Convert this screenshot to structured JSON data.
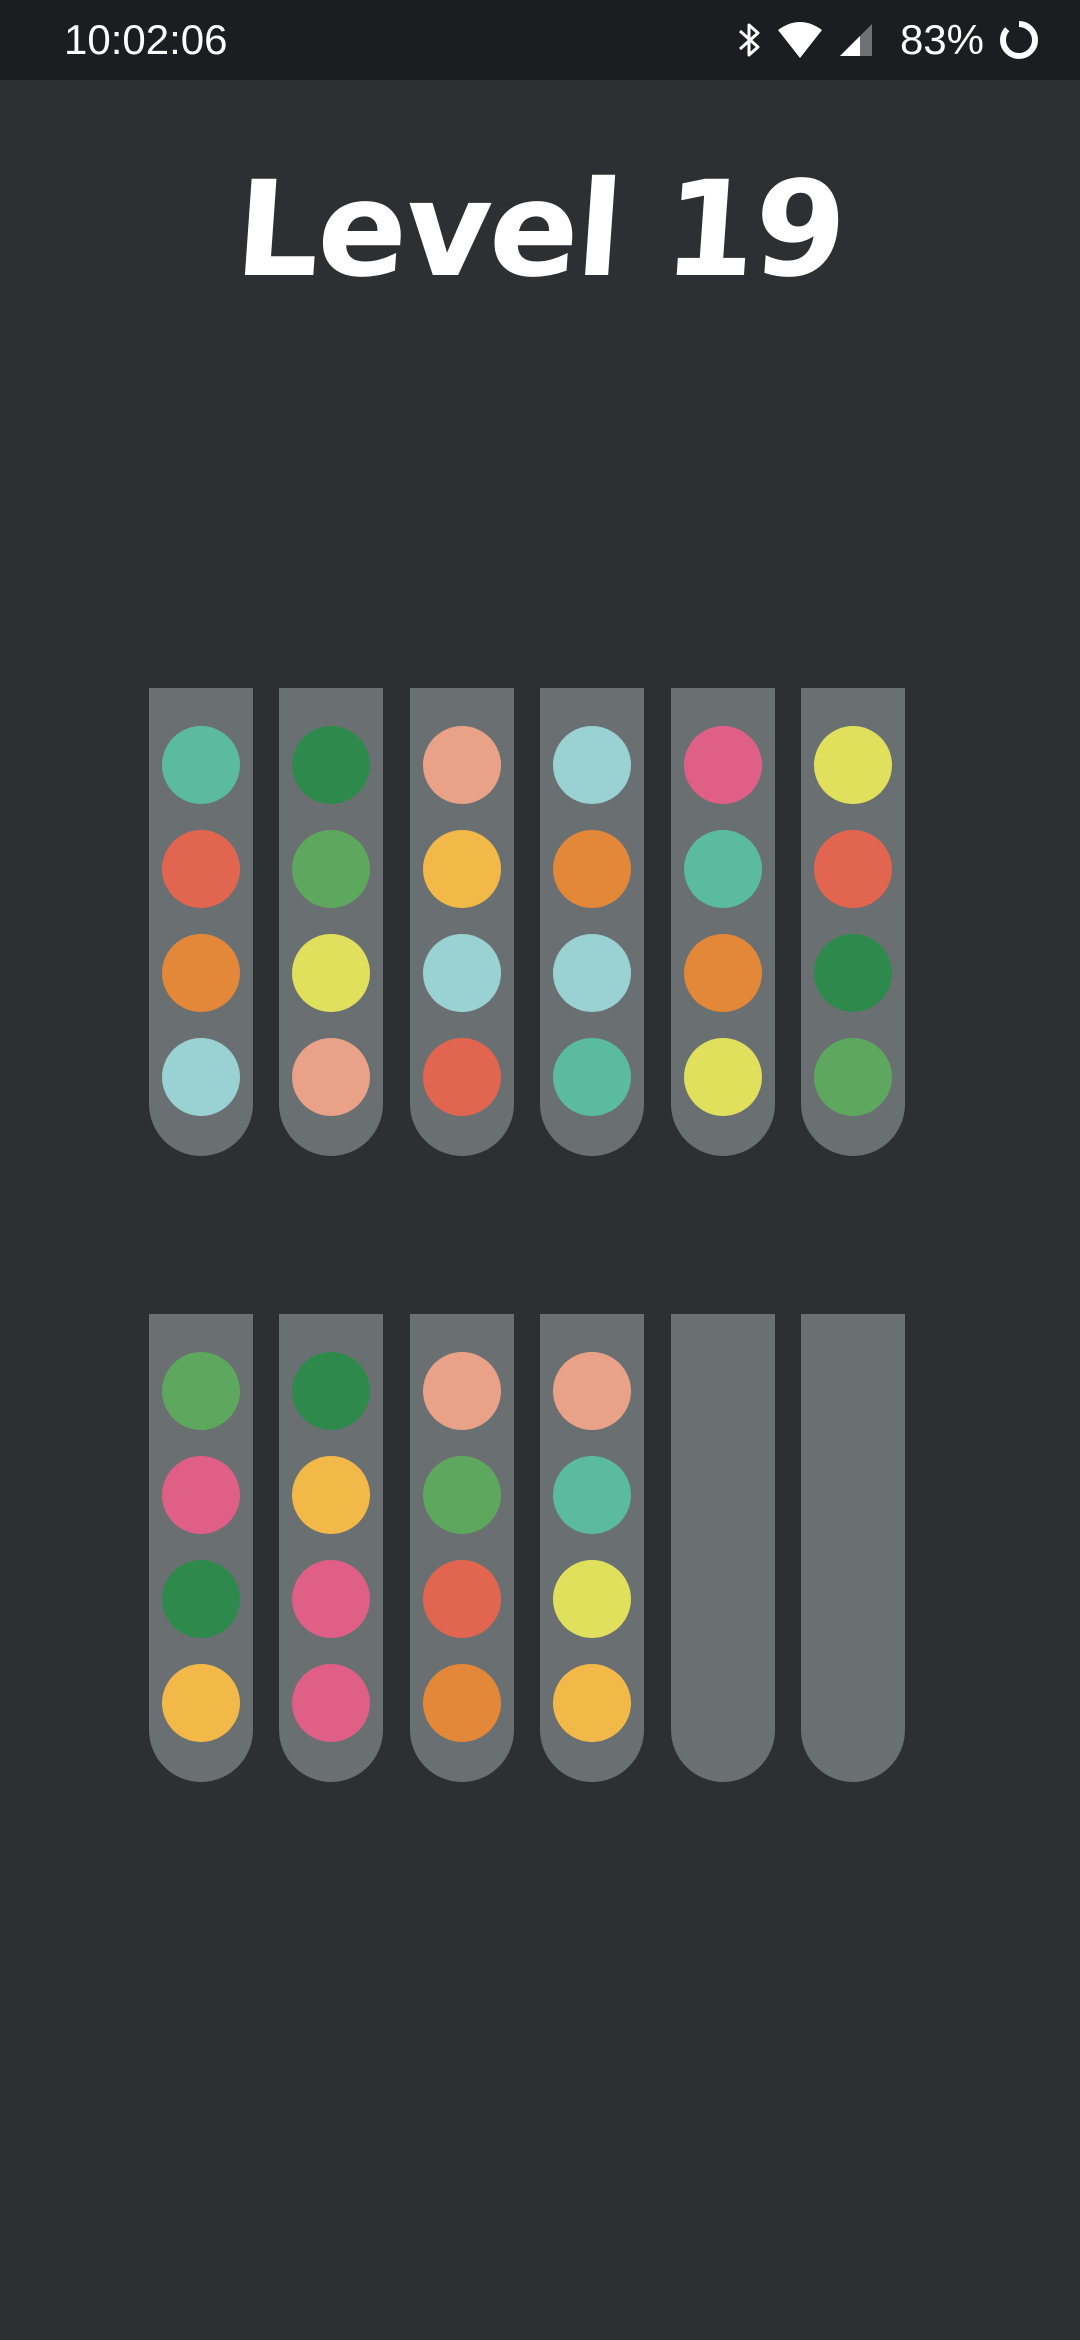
{
  "status_bar": {
    "time": "10:02:06",
    "battery": "83%"
  },
  "title": "Level 19",
  "colors": {
    "teal": "#5bbb9f",
    "red": "#e2664f",
    "orange": "#e38739",
    "lightblue": "#9ad2d4",
    "darkgreen": "#2e8a4c",
    "green": "#5ea75e",
    "yellow": "#e0e05c",
    "peach": "#e9a188",
    "gold": "#f3b948",
    "pink": "#df5f86"
  },
  "tubes": [
    [
      "teal",
      "red",
      "orange",
      "lightblue"
    ],
    [
      "darkgreen",
      "green",
      "yellow",
      "peach"
    ],
    [
      "peach",
      "gold",
      "lightblue",
      "red"
    ],
    [
      "lightblue",
      "orange",
      "lightblue",
      "teal"
    ],
    [
      "pink",
      "teal",
      "orange",
      "yellow"
    ],
    [
      "yellow",
      "red",
      "darkgreen",
      "green"
    ],
    [
      "green",
      "pink",
      "darkgreen",
      "gold"
    ],
    [
      "darkgreen",
      "gold",
      "pink",
      "pink"
    ],
    [
      "peach",
      "green",
      "red",
      "orange"
    ],
    [
      "peach",
      "teal",
      "yellow",
      "gold"
    ],
    [],
    []
  ]
}
